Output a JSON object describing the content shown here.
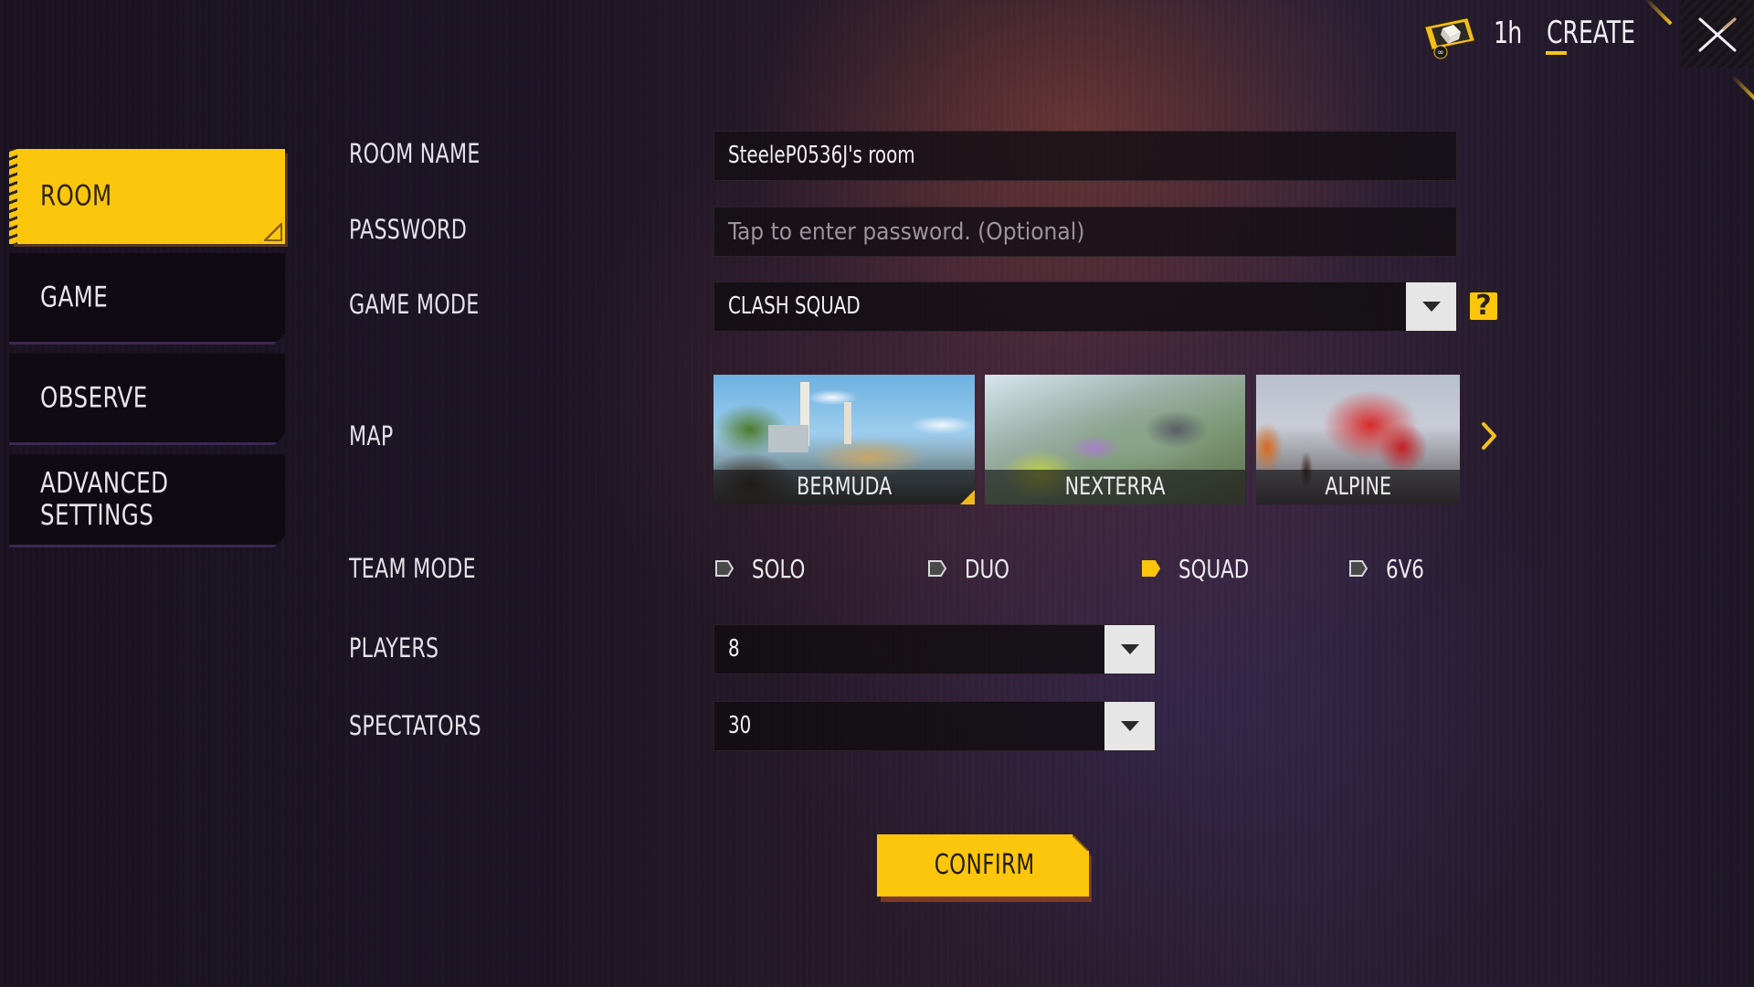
{
  "header": {
    "ticket_icon": "room-card-ticket-icon",
    "duration": "1h",
    "title": "CREATE",
    "close_icon": "close-icon"
  },
  "sidebar": {
    "items": [
      {
        "label": "ROOM",
        "active": true
      },
      {
        "label": "GAME",
        "active": false
      },
      {
        "label": "OBSERVE",
        "active": false
      },
      {
        "label": "ADVANCED SETTINGS",
        "active": false
      }
    ]
  },
  "form": {
    "room_name": {
      "label": "ROOM NAME",
      "value": "SteeleP0536J's room"
    },
    "password": {
      "label": "PASSWORD",
      "value": "",
      "placeholder": "Tap to enter password. (Optional)"
    },
    "game_mode": {
      "label": "GAME MODE",
      "value": "CLASH SQUAD",
      "help_icon": "?"
    },
    "map": {
      "label": "MAP",
      "options": [
        {
          "name": "BERMUDA",
          "selected": true
        },
        {
          "name": "NEXTERRA",
          "selected": false
        },
        {
          "name": "ALPINE",
          "selected": false
        }
      ],
      "next_icon": "chevron-right-icon"
    },
    "team_mode": {
      "label": "TEAM MODE",
      "options": [
        {
          "label": "SOLO",
          "selected": false
        },
        {
          "label": "DUO",
          "selected": false
        },
        {
          "label": "SQUAD",
          "selected": true
        },
        {
          "label": "6V6",
          "selected": false
        }
      ]
    },
    "players": {
      "label": "PLAYERS",
      "value": "8"
    },
    "spectators": {
      "label": "SPECTATORS",
      "value": "30"
    }
  },
  "actions": {
    "confirm_label": "CONFIRM"
  },
  "colors": {
    "accent": "#fcc60d",
    "radio_unselected": "#4a4a4a",
    "text": "#e6e4ea"
  }
}
